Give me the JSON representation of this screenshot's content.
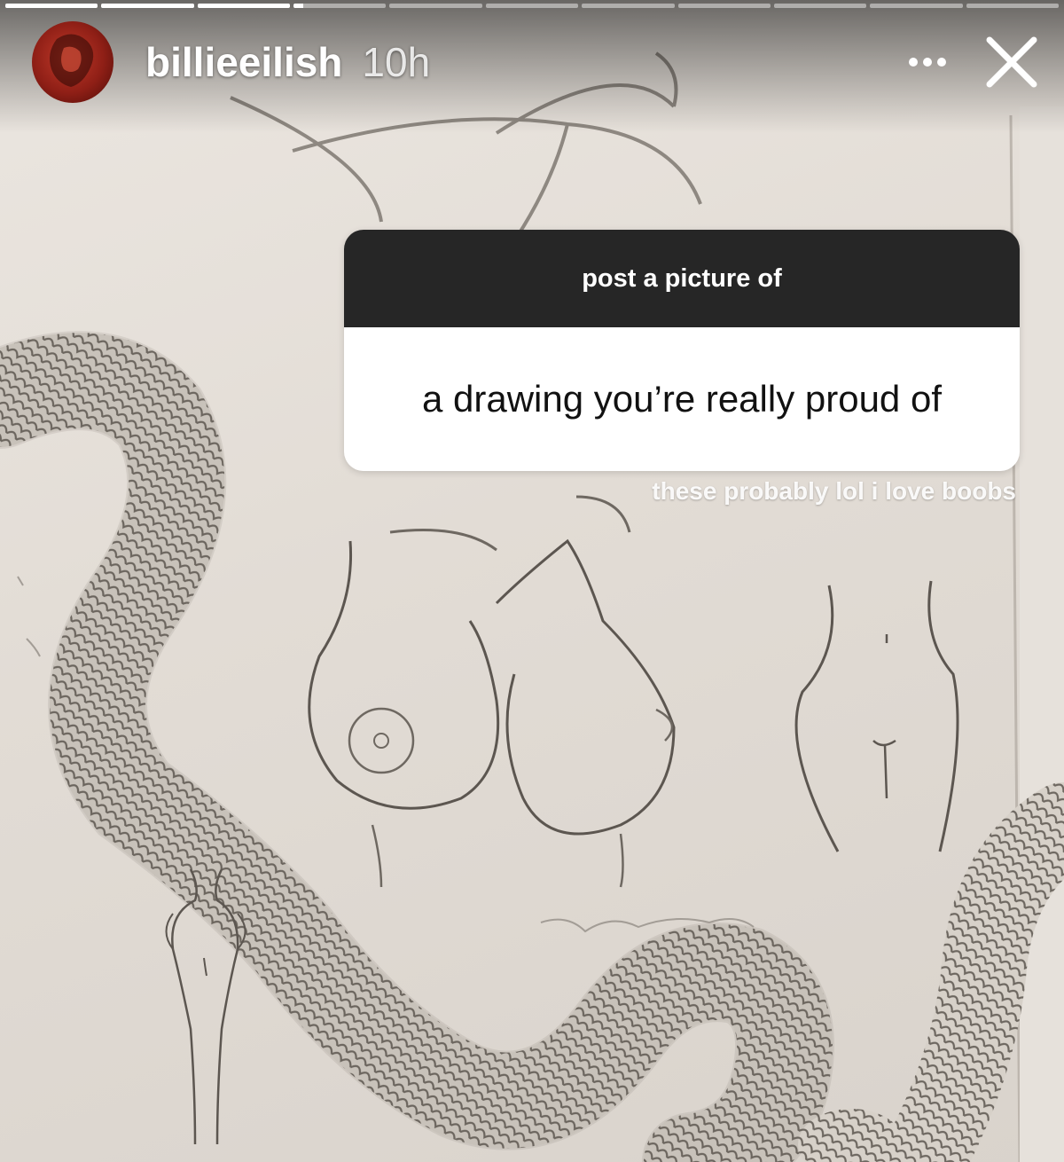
{
  "story": {
    "segment_count": 11,
    "segments_complete": 3,
    "current_segment_progress": 0.1
  },
  "header": {
    "username": "billieeilish",
    "time_ago": "10h"
  },
  "icons": {
    "more": "more-horizontal-icon",
    "close": "close-icon"
  },
  "question_sticker": {
    "prompt": "post a picture of",
    "response": "a drawing you’re really proud of"
  },
  "caption": "these probably lol i love boobs",
  "colors": {
    "sticker_header": "#262626",
    "sticker_body": "#ffffff",
    "avatar_accent": "#c23a2a"
  }
}
